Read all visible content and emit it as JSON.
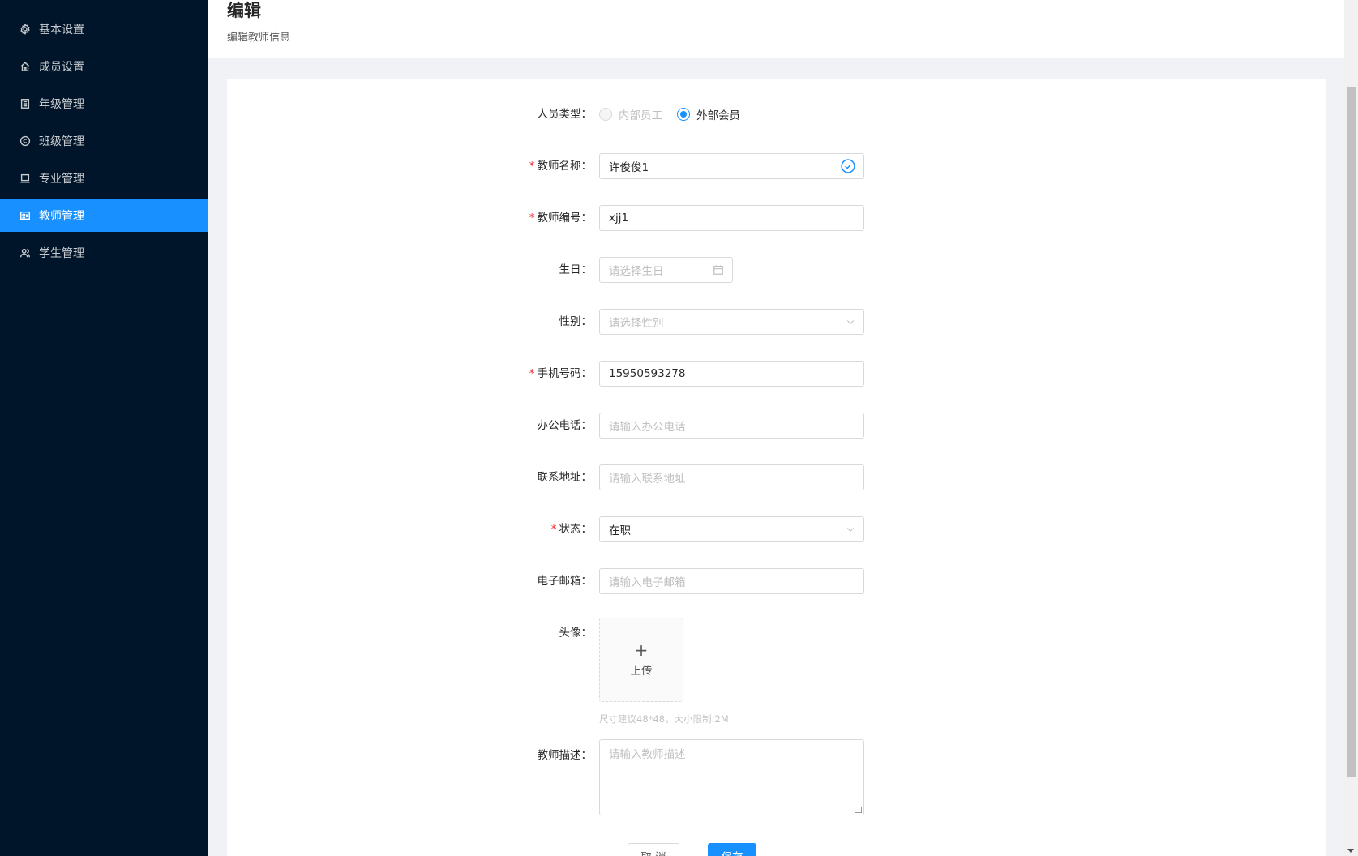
{
  "sidebar": {
    "items": [
      {
        "label": "基本设置",
        "icon": "gear-icon"
      },
      {
        "label": "成员设置",
        "icon": "home-icon"
      },
      {
        "label": "年级管理",
        "icon": "building-icon"
      },
      {
        "label": "班级管理",
        "icon": "copyright-icon"
      },
      {
        "label": "专业管理",
        "icon": "laptop-icon"
      },
      {
        "label": "教师管理",
        "icon": "idcard-icon",
        "active": true
      },
      {
        "label": "学生管理",
        "icon": "team-icon"
      }
    ]
  },
  "header": {
    "title": "编辑",
    "subtitle": "编辑教师信息"
  },
  "form": {
    "person_type": {
      "label": "人员类型：",
      "options": [
        "内部员工",
        "外部会员"
      ],
      "selected": "外部会员"
    },
    "teacher_name": {
      "label": "教师名称：",
      "value": "许俊俊1"
    },
    "teacher_no": {
      "label": "教师编号：",
      "value": "xjj1"
    },
    "birthday": {
      "label": "生日：",
      "placeholder": "请选择生日"
    },
    "gender": {
      "label": "性别：",
      "placeholder": "请选择性别"
    },
    "mobile": {
      "label": "手机号码：",
      "value": "15950593278"
    },
    "office_phone": {
      "label": "办公电话：",
      "placeholder": "请输入办公电话"
    },
    "address": {
      "label": "联系地址：",
      "placeholder": "请输入联系地址"
    },
    "status": {
      "label": "状态：",
      "value": "在职"
    },
    "email": {
      "label": "电子邮箱：",
      "placeholder": "请输入电子邮箱"
    },
    "avatar": {
      "label": "头像：",
      "upload_text": "上传",
      "hint": "尺寸建议48*48，大小限制:2M"
    },
    "description": {
      "label": "教师描述：",
      "placeholder": "请输入教师描述"
    },
    "required_mark": "*"
  },
  "actions": {
    "cancel": "取 消",
    "save": "保存"
  },
  "colors": {
    "sidebar_bg": "#001529",
    "primary": "#1890ff",
    "required": "#f5222d"
  }
}
